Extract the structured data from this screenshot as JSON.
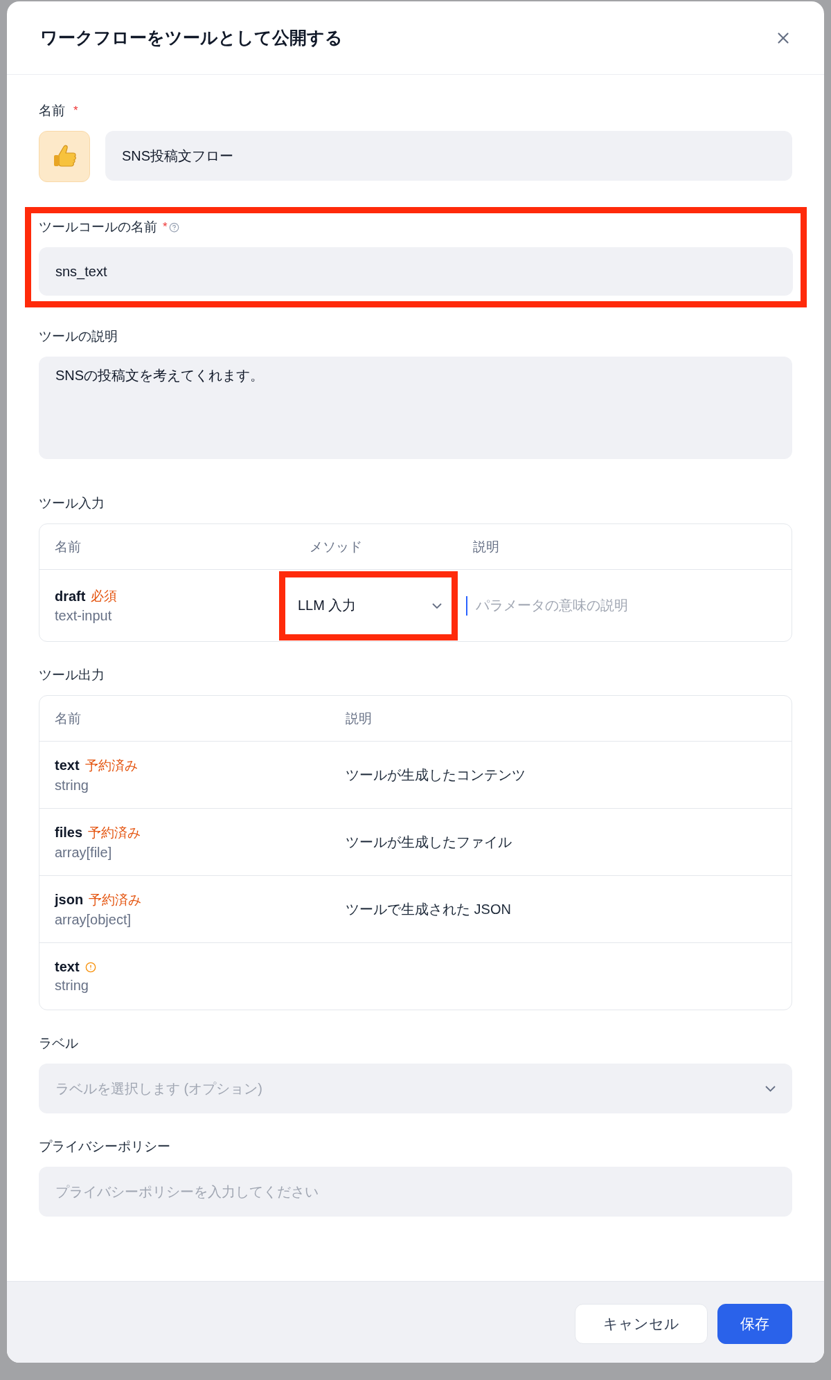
{
  "dialog": {
    "title": "ワークフローをツールとして公開する"
  },
  "name_field": {
    "label": "名前",
    "required_mark": "*",
    "value": "SNS投稿文フロー"
  },
  "tool_call_name": {
    "label": "ツールコールの名前",
    "required_mark": "*",
    "value": "sns_text",
    "highlighted": true
  },
  "description": {
    "label": "ツールの説明",
    "value": "SNSの投稿文を考えてくれます。"
  },
  "tool_input": {
    "title": "ツール入力",
    "columns": [
      "名前",
      "メソッド",
      "説明"
    ],
    "rows": [
      {
        "name": "draft",
        "badge": "必須",
        "type": "text-input",
        "method": "LLM 入力",
        "method_highlighted": true,
        "placeholder": "パラメータの意味の説明"
      }
    ]
  },
  "tool_output": {
    "title": "ツール出力",
    "columns": [
      "名前",
      "説明"
    ],
    "rows": [
      {
        "name": "text",
        "badge": "予約済み",
        "type": "string",
        "description": "ツールが生成したコンテンツ",
        "warning": false
      },
      {
        "name": "files",
        "badge": "予約済み",
        "type": "array[file]",
        "description": "ツールが生成したファイル",
        "warning": false
      },
      {
        "name": "json",
        "badge": "予約済み",
        "type": "array[object]",
        "description": "ツールで生成された JSON",
        "warning": false
      },
      {
        "name": "text",
        "type": "string",
        "warning": true
      }
    ]
  },
  "label": {
    "label": "ラベル",
    "placeholder": "ラベルを選択します (オプション)"
  },
  "privacy": {
    "label": "プライバシーポリシー",
    "placeholder": "プライバシーポリシーを入力してください"
  },
  "buttons": [
    {
      "label": "キャンセル",
      "kind": "secondary"
    },
    {
      "label": "保存",
      "kind": "primary"
    }
  ]
}
